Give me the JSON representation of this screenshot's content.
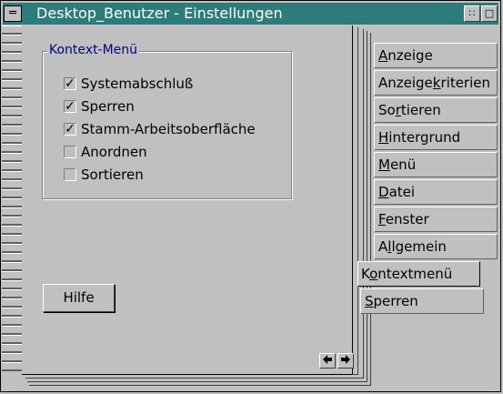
{
  "window": {
    "title": "Desktop_Benutzer - Einstellungen",
    "sysmenu_glyph": "═",
    "restore_glyph": "∷",
    "maximize_glyph": "□",
    "titlebar_color": "#2d7c7c"
  },
  "group": {
    "label": "Kontext-Menü",
    "items": [
      {
        "label": "Systemabschluß",
        "checked": true,
        "mark": "✓"
      },
      {
        "label": "Sperren",
        "checked": true,
        "mark": "✓"
      },
      {
        "label": "Stamm-Arbeitsoberfläche",
        "checked": true,
        "mark": "✓"
      },
      {
        "label": "Anordnen",
        "checked": false,
        "mark": ""
      },
      {
        "label": "Sortieren",
        "checked": false,
        "mark": ""
      }
    ]
  },
  "buttons": {
    "help": "Hilfe",
    "prev": "🡐",
    "next": "🡒"
  },
  "tabs": [
    {
      "label": "Anzeige",
      "accel": "A",
      "rest": "nzeige"
    },
    {
      "label": "Anzeigekriterien",
      "pre": "Anzeige",
      "accel": "k",
      "rest": "riterien"
    },
    {
      "label": "Sortieren",
      "pre": "So",
      "accel": "r",
      "rest": "tieren"
    },
    {
      "label": "Hintergrund",
      "accel": "H",
      "rest": "intergrund"
    },
    {
      "label": "Menü",
      "accel": "M",
      "rest": "enü"
    },
    {
      "label": "Datei",
      "accel": "D",
      "rest": "atei"
    },
    {
      "label": "Fenster",
      "accel": "F",
      "rest": "enster"
    },
    {
      "label": "Allgemein",
      "pre": "A",
      "accel": "l",
      "rest": "lgemein"
    },
    {
      "label": "Kontextmenü",
      "pre": "K",
      "accel": "o",
      "rest": "ntextmenü",
      "active": true
    },
    {
      "label": "Sperren",
      "accel": "S",
      "rest": "perren"
    }
  ]
}
